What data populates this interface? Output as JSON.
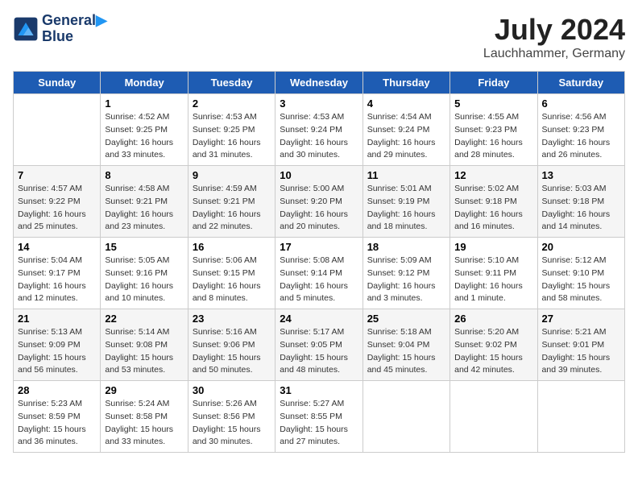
{
  "header": {
    "logo_line1": "General",
    "logo_line2": "Blue",
    "month": "July 2024",
    "location": "Lauchhammer, Germany"
  },
  "weekdays": [
    "Sunday",
    "Monday",
    "Tuesday",
    "Wednesday",
    "Thursday",
    "Friday",
    "Saturday"
  ],
  "weeks": [
    [
      {
        "day": "",
        "sunrise": "",
        "sunset": "",
        "daylight": ""
      },
      {
        "day": "1",
        "sunrise": "Sunrise: 4:52 AM",
        "sunset": "Sunset: 9:25 PM",
        "daylight": "Daylight: 16 hours and 33 minutes."
      },
      {
        "day": "2",
        "sunrise": "Sunrise: 4:53 AM",
        "sunset": "Sunset: 9:25 PM",
        "daylight": "Daylight: 16 hours and 31 minutes."
      },
      {
        "day": "3",
        "sunrise": "Sunrise: 4:53 AM",
        "sunset": "Sunset: 9:24 PM",
        "daylight": "Daylight: 16 hours and 30 minutes."
      },
      {
        "day": "4",
        "sunrise": "Sunrise: 4:54 AM",
        "sunset": "Sunset: 9:24 PM",
        "daylight": "Daylight: 16 hours and 29 minutes."
      },
      {
        "day": "5",
        "sunrise": "Sunrise: 4:55 AM",
        "sunset": "Sunset: 9:23 PM",
        "daylight": "Daylight: 16 hours and 28 minutes."
      },
      {
        "day": "6",
        "sunrise": "Sunrise: 4:56 AM",
        "sunset": "Sunset: 9:23 PM",
        "daylight": "Daylight: 16 hours and 26 minutes."
      }
    ],
    [
      {
        "day": "7",
        "sunrise": "Sunrise: 4:57 AM",
        "sunset": "Sunset: 9:22 PM",
        "daylight": "Daylight: 16 hours and 25 minutes."
      },
      {
        "day": "8",
        "sunrise": "Sunrise: 4:58 AM",
        "sunset": "Sunset: 9:21 PM",
        "daylight": "Daylight: 16 hours and 23 minutes."
      },
      {
        "day": "9",
        "sunrise": "Sunrise: 4:59 AM",
        "sunset": "Sunset: 9:21 PM",
        "daylight": "Daylight: 16 hours and 22 minutes."
      },
      {
        "day": "10",
        "sunrise": "Sunrise: 5:00 AM",
        "sunset": "Sunset: 9:20 PM",
        "daylight": "Daylight: 16 hours and 20 minutes."
      },
      {
        "day": "11",
        "sunrise": "Sunrise: 5:01 AM",
        "sunset": "Sunset: 9:19 PM",
        "daylight": "Daylight: 16 hours and 18 minutes."
      },
      {
        "day": "12",
        "sunrise": "Sunrise: 5:02 AM",
        "sunset": "Sunset: 9:18 PM",
        "daylight": "Daylight: 16 hours and 16 minutes."
      },
      {
        "day": "13",
        "sunrise": "Sunrise: 5:03 AM",
        "sunset": "Sunset: 9:18 PM",
        "daylight": "Daylight: 16 hours and 14 minutes."
      }
    ],
    [
      {
        "day": "14",
        "sunrise": "Sunrise: 5:04 AM",
        "sunset": "Sunset: 9:17 PM",
        "daylight": "Daylight: 16 hours and 12 minutes."
      },
      {
        "day": "15",
        "sunrise": "Sunrise: 5:05 AM",
        "sunset": "Sunset: 9:16 PM",
        "daylight": "Daylight: 16 hours and 10 minutes."
      },
      {
        "day": "16",
        "sunrise": "Sunrise: 5:06 AM",
        "sunset": "Sunset: 9:15 PM",
        "daylight": "Daylight: 16 hours and 8 minutes."
      },
      {
        "day": "17",
        "sunrise": "Sunrise: 5:08 AM",
        "sunset": "Sunset: 9:14 PM",
        "daylight": "Daylight: 16 hours and 5 minutes."
      },
      {
        "day": "18",
        "sunrise": "Sunrise: 5:09 AM",
        "sunset": "Sunset: 9:12 PM",
        "daylight": "Daylight: 16 hours and 3 minutes."
      },
      {
        "day": "19",
        "sunrise": "Sunrise: 5:10 AM",
        "sunset": "Sunset: 9:11 PM",
        "daylight": "Daylight: 16 hours and 1 minute."
      },
      {
        "day": "20",
        "sunrise": "Sunrise: 5:12 AM",
        "sunset": "Sunset: 9:10 PM",
        "daylight": "Daylight: 15 hours and 58 minutes."
      }
    ],
    [
      {
        "day": "21",
        "sunrise": "Sunrise: 5:13 AM",
        "sunset": "Sunset: 9:09 PM",
        "daylight": "Daylight: 15 hours and 56 minutes."
      },
      {
        "day": "22",
        "sunrise": "Sunrise: 5:14 AM",
        "sunset": "Sunset: 9:08 PM",
        "daylight": "Daylight: 15 hours and 53 minutes."
      },
      {
        "day": "23",
        "sunrise": "Sunrise: 5:16 AM",
        "sunset": "Sunset: 9:06 PM",
        "daylight": "Daylight: 15 hours and 50 minutes."
      },
      {
        "day": "24",
        "sunrise": "Sunrise: 5:17 AM",
        "sunset": "Sunset: 9:05 PM",
        "daylight": "Daylight: 15 hours and 48 minutes."
      },
      {
        "day": "25",
        "sunrise": "Sunrise: 5:18 AM",
        "sunset": "Sunset: 9:04 PM",
        "daylight": "Daylight: 15 hours and 45 minutes."
      },
      {
        "day": "26",
        "sunrise": "Sunrise: 5:20 AM",
        "sunset": "Sunset: 9:02 PM",
        "daylight": "Daylight: 15 hours and 42 minutes."
      },
      {
        "day": "27",
        "sunrise": "Sunrise: 5:21 AM",
        "sunset": "Sunset: 9:01 PM",
        "daylight": "Daylight: 15 hours and 39 minutes."
      }
    ],
    [
      {
        "day": "28",
        "sunrise": "Sunrise: 5:23 AM",
        "sunset": "Sunset: 8:59 PM",
        "daylight": "Daylight: 15 hours and 36 minutes."
      },
      {
        "day": "29",
        "sunrise": "Sunrise: 5:24 AM",
        "sunset": "Sunset: 8:58 PM",
        "daylight": "Daylight: 15 hours and 33 minutes."
      },
      {
        "day": "30",
        "sunrise": "Sunrise: 5:26 AM",
        "sunset": "Sunset: 8:56 PM",
        "daylight": "Daylight: 15 hours and 30 minutes."
      },
      {
        "day": "31",
        "sunrise": "Sunrise: 5:27 AM",
        "sunset": "Sunset: 8:55 PM",
        "daylight": "Daylight: 15 hours and 27 minutes."
      },
      {
        "day": "",
        "sunrise": "",
        "sunset": "",
        "daylight": ""
      },
      {
        "day": "",
        "sunrise": "",
        "sunset": "",
        "daylight": ""
      },
      {
        "day": "",
        "sunrise": "",
        "sunset": "",
        "daylight": ""
      }
    ]
  ]
}
